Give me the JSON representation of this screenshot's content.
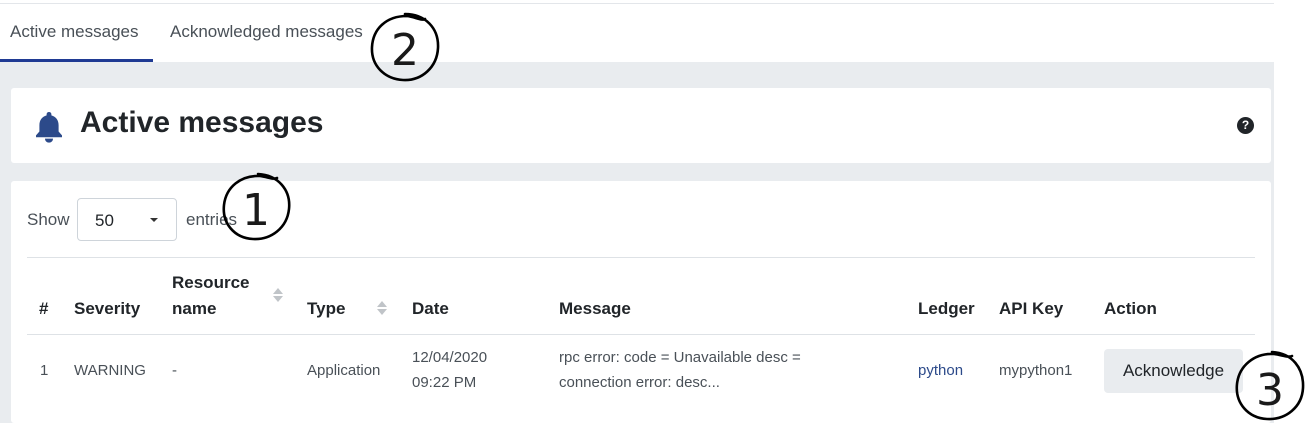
{
  "tabs": [
    {
      "label": "Active messages"
    },
    {
      "label": "Acknowledged messages"
    }
  ],
  "header": {
    "title": "Active messages",
    "icon": "bell-icon",
    "help_icon": "question-circle-icon",
    "help_glyph": "?"
  },
  "entries_control": {
    "show_label": "Show",
    "selected": "50",
    "entries_label": "entries"
  },
  "table": {
    "columns": {
      "num": "#",
      "severity": "Severity",
      "resource_line1": "Resource",
      "resource_line2": "name",
      "type": "Type",
      "date": "Date",
      "message": "Message",
      "ledger": "Ledger",
      "api_key": "API Key",
      "action": "Action"
    },
    "rows": [
      {
        "num": "1",
        "severity": "WARNING",
        "resource": "-",
        "type": "Application",
        "date_line1": "12/04/2020",
        "date_line2": "09:22 PM",
        "message_line1": "rpc error: code = Unavailable desc =",
        "message_line2": "connection error: desc...",
        "ledger": "python",
        "api_key": "mypython1",
        "action": "Acknowledge"
      }
    ]
  },
  "annotations": [
    "1",
    "2",
    "3"
  ],
  "colors": {
    "accent": "#1f3a93",
    "content_background": "#e9ecef",
    "link": "#2c4a8a"
  }
}
